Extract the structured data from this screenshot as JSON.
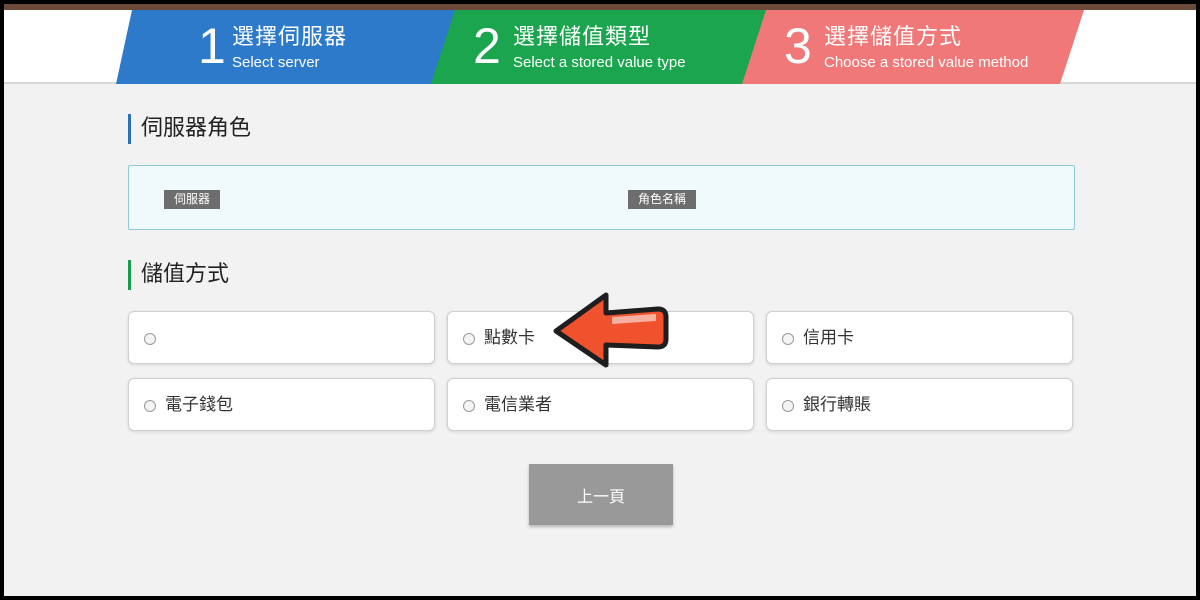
{
  "steps": [
    {
      "num": "1",
      "title_zh": "選擇伺服器",
      "title_en": "Select server",
      "color": "#2c7ac9"
    },
    {
      "num": "2",
      "title_zh": "選擇儲值類型",
      "title_en": "Select a stored value type",
      "color": "#1aa54e"
    },
    {
      "num": "3",
      "title_zh": "選擇儲值方式",
      "title_en": "Choose a stored value method",
      "color": "#f07878"
    }
  ],
  "server_section": {
    "title": "伺服器角色",
    "server_tag": "伺服器",
    "role_tag": "角色名稱"
  },
  "method_section": {
    "title": "儲值方式",
    "options": [
      {
        "label": ""
      },
      {
        "label": "點數卡"
      },
      {
        "label": "信用卡"
      },
      {
        "label": "電子錢包"
      },
      {
        "label": "電信業者"
      },
      {
        "label": "銀行轉賬"
      }
    ]
  },
  "back_button": "上一頁",
  "colors": {
    "accent_blue": "#2b6fb7",
    "accent_green": "#1a9a4a",
    "arrow": "#f0522e"
  }
}
